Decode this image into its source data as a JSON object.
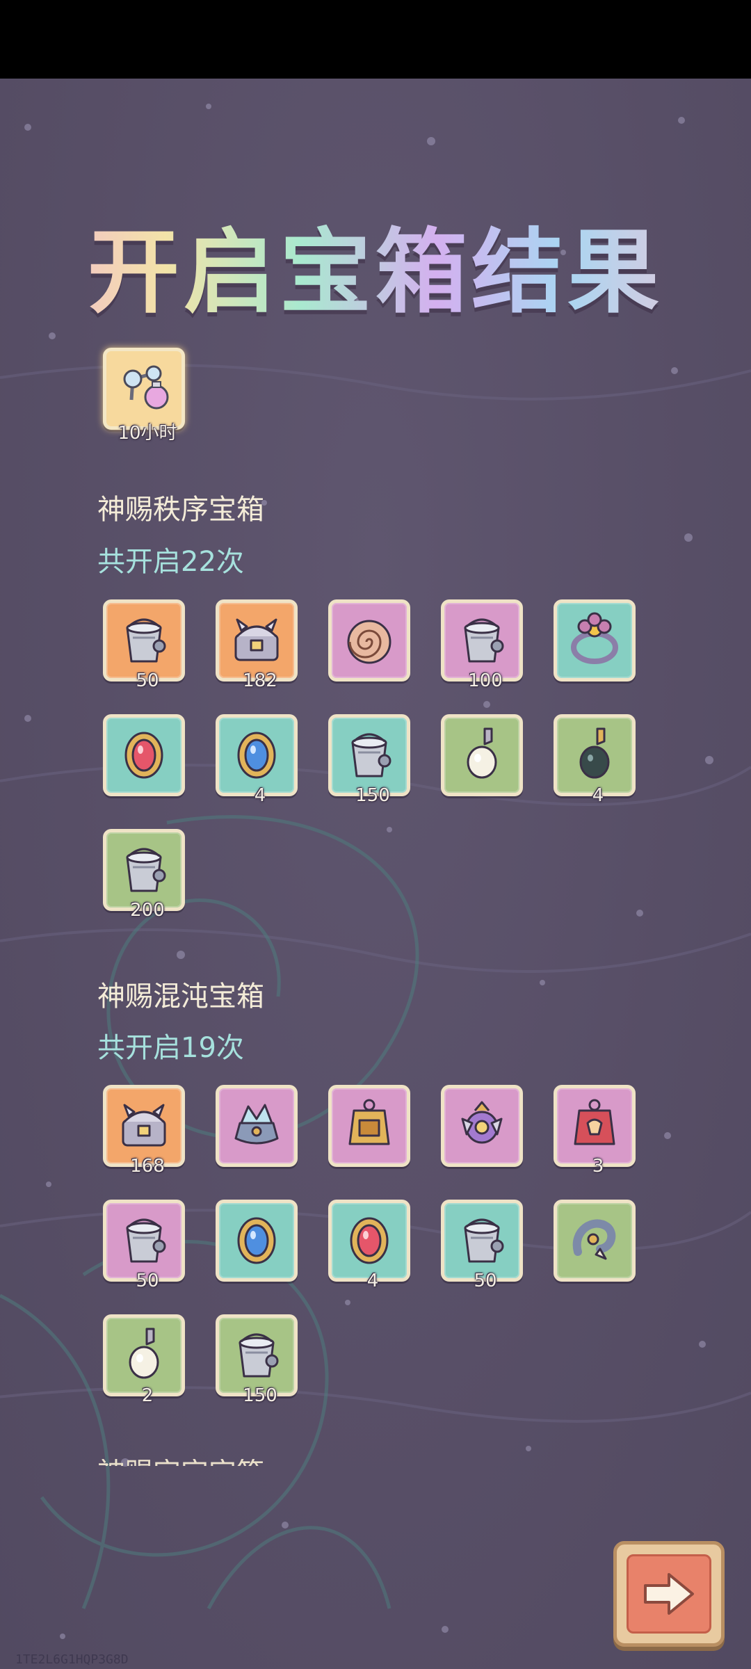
{
  "title": "开启宝箱结果",
  "time_item": {
    "icon": "molecule-potion-icon",
    "label": "10小时"
  },
  "sections": [
    {
      "name": "神赐秩序宝箱",
      "count": "共开启22次",
      "items": [
        {
          "icon": "paint-bucket-icon",
          "color": "orange",
          "qty": "50"
        },
        {
          "icon": "armor-chest-icon",
          "color": "orange",
          "qty": "182"
        },
        {
          "icon": "ammonite-shell-icon",
          "color": "pink",
          "qty": ""
        },
        {
          "icon": "paint-bucket-icon",
          "color": "pink",
          "qty": "100"
        },
        {
          "icon": "flower-ring-icon",
          "color": "teal",
          "qty": ""
        },
        {
          "icon": "red-gem-amulet-icon",
          "color": "teal",
          "qty": ""
        },
        {
          "icon": "blue-gem-amulet-icon",
          "color": "teal",
          "qty": "4"
        },
        {
          "icon": "paint-bucket-icon",
          "color": "teal",
          "qty": "150"
        },
        {
          "icon": "white-pearl-pendant-icon",
          "color": "green",
          "qty": ""
        },
        {
          "icon": "black-pearl-pendant-icon",
          "color": "green",
          "qty": "4"
        },
        {
          "icon": "paint-bucket-icon",
          "color": "green",
          "qty": "200"
        }
      ]
    },
    {
      "name": "神赐混沌宝箱",
      "count": "共开启19次",
      "items": [
        {
          "icon": "armor-chest-icon",
          "color": "orange",
          "qty": "168"
        },
        {
          "icon": "crystal-crown-icon",
          "color": "pink",
          "qty": ""
        },
        {
          "icon": "gold-tag-icon",
          "color": "pink",
          "qty": ""
        },
        {
          "icon": "purple-ornament-icon",
          "color": "pink",
          "qty": ""
        },
        {
          "icon": "red-tag-icon",
          "color": "pink",
          "qty": "3"
        },
        {
          "icon": "paint-bucket-icon",
          "color": "pink",
          "qty": "50"
        },
        {
          "icon": "blue-gem-amulet-icon",
          "color": "teal",
          "qty": ""
        },
        {
          "icon": "red-gem-amulet-icon",
          "color": "teal",
          "qty": "4"
        },
        {
          "icon": "paint-bucket-icon",
          "color": "teal",
          "qty": "50"
        },
        {
          "icon": "dragon-claw-icon",
          "color": "green",
          "qty": ""
        },
        {
          "icon": "white-pearl-pendant-icon",
          "color": "green",
          "qty": "2"
        },
        {
          "icon": "paint-bucket-icon",
          "color": "green",
          "qty": "150"
        }
      ]
    }
  ],
  "next_button": {
    "icon": "arrow-right-icon"
  },
  "footer": "1TE2L6G1HQP3G8D",
  "palette": {
    "orange": "#f3a66a",
    "pink": "#d89ac9",
    "teal": "#86cfc2",
    "green": "#a7c486",
    "tile_border": "#efe3c6",
    "section_name": "#f4ecd8",
    "section_count": "#a6e1dd"
  }
}
